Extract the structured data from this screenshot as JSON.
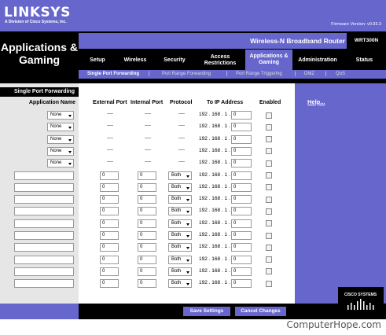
{
  "brand": {
    "logo": "LINKSYS",
    "subtitle": "A Division of Cisco Systems, Inc."
  },
  "firmware": "Firmware Version: v0.93.3",
  "section_title": "Applications & Gaming",
  "product_name": "Wireless-N Broadband Router",
  "model": "WRT300N",
  "tabs": [
    {
      "label": "Setup"
    },
    {
      "label": "Wireless"
    },
    {
      "label": "Security"
    },
    {
      "label": "Access Restrictions"
    },
    {
      "label": "Applications & Gaming"
    },
    {
      "label": "Administration"
    },
    {
      "label": "Status"
    }
  ],
  "subnav": [
    "Single Port Forwarding",
    "Port Range Forwarding",
    "Port Range Triggering",
    "DMZ",
    "QoS"
  ],
  "left": {
    "heading": "Single Port Forwarding",
    "column": "Application Name"
  },
  "headers": {
    "external_port": "External Port",
    "internal_port": "Internal Port",
    "protocol": "Protocol",
    "ip": "To IP Address",
    "enabled": "Enabled"
  },
  "help": "Help...",
  "preset_rows": [
    {
      "app": "None",
      "ext": "----",
      "int": "----",
      "proto": "----",
      "ip_prefix": "192 . 168 . 1 .",
      "ip_last": "0"
    },
    {
      "app": "None",
      "ext": "----",
      "int": "----",
      "proto": "----",
      "ip_prefix": "192 . 168 . 1 .",
      "ip_last": "0"
    },
    {
      "app": "None",
      "ext": "----",
      "int": "----",
      "proto": "----",
      "ip_prefix": "192 . 168 . 1 .",
      "ip_last": "0"
    },
    {
      "app": "None",
      "ext": "----",
      "int": "----",
      "proto": "----",
      "ip_prefix": "192 . 168 . 1 .",
      "ip_last": "0"
    },
    {
      "app": "None",
      "ext": "----",
      "int": "----",
      "proto": "----",
      "ip_prefix": "192 . 168 . 1 .",
      "ip_last": "0"
    }
  ],
  "custom_rows": [
    {
      "app": "",
      "ext": "0",
      "int": "0",
      "proto": "Both",
      "ip_prefix": "192 . 168 . 1 .",
      "ip_last": "0"
    },
    {
      "app": "",
      "ext": "0",
      "int": "0",
      "proto": "Both",
      "ip_prefix": "192 . 168 . 1 .",
      "ip_last": "0"
    },
    {
      "app": "",
      "ext": "0",
      "int": "0",
      "proto": "Both",
      "ip_prefix": "192 . 168 . 1 .",
      "ip_last": "0"
    },
    {
      "app": "",
      "ext": "0",
      "int": "0",
      "proto": "Both",
      "ip_prefix": "192 . 168 . 1 .",
      "ip_last": "0"
    },
    {
      "app": "",
      "ext": "0",
      "int": "0",
      "proto": "Both",
      "ip_prefix": "192 . 168 . 1 .",
      "ip_last": "0"
    },
    {
      "app": "",
      "ext": "0",
      "int": "0",
      "proto": "Both",
      "ip_prefix": "192 . 168 . 1 .",
      "ip_last": "0"
    },
    {
      "app": "",
      "ext": "0",
      "int": "0",
      "proto": "Both",
      "ip_prefix": "192 . 168 . 1 .",
      "ip_last": "0"
    },
    {
      "app": "",
      "ext": "0",
      "int": "0",
      "proto": "Both",
      "ip_prefix": "192 . 168 . 1 .",
      "ip_last": "0"
    },
    {
      "app": "",
      "ext": "0",
      "int": "0",
      "proto": "Both",
      "ip_prefix": "192 . 168 . 1 .",
      "ip_last": "0"
    },
    {
      "app": "",
      "ext": "0",
      "int": "0",
      "proto": "Both",
      "ip_prefix": "192 . 168 . 1 .",
      "ip_last": "0"
    }
  ],
  "buttons": {
    "save": "Save Settings",
    "cancel": "Cancel Changes"
  },
  "cisco": "CISCO SYSTEMS",
  "watermark": "ComputerHope.com",
  "colors": {
    "purple": "#6666cc",
    "black": "#000000",
    "panel": "#e6e6e6"
  }
}
